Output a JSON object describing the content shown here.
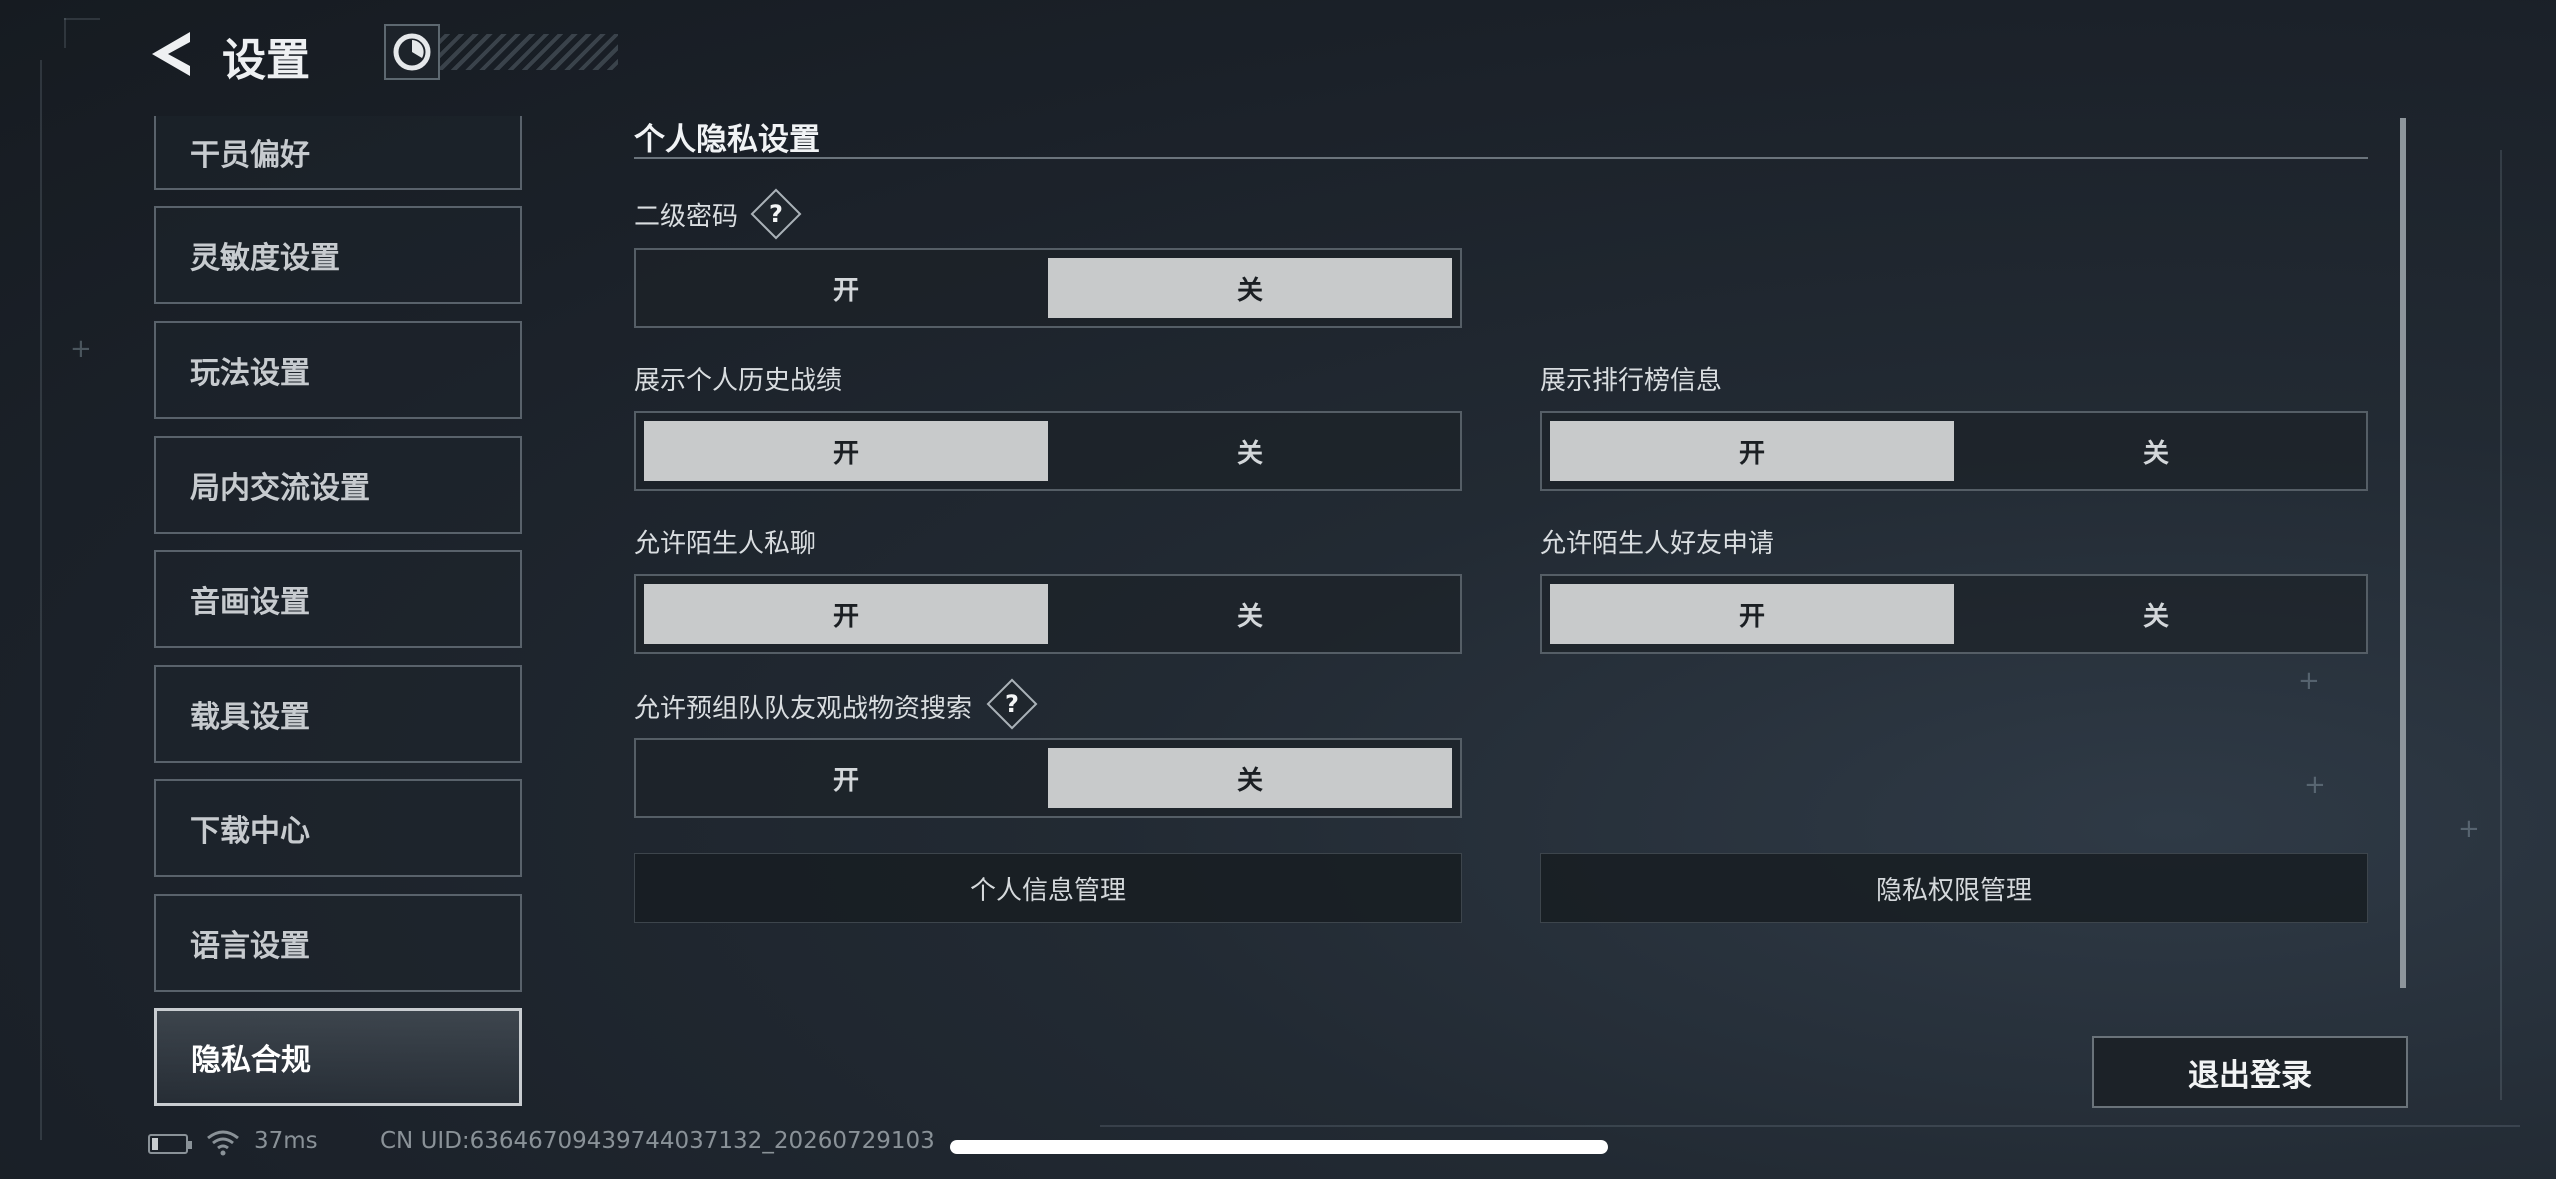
{
  "header": {
    "title": "设置",
    "back_icon": "back-arrow-icon",
    "logo_icon": "game-logo-icon"
  },
  "sidebar": {
    "items": [
      {
        "label": "干员偏好",
        "active": false
      },
      {
        "label": "灵敏度设置",
        "active": false
      },
      {
        "label": "玩法设置",
        "active": false
      },
      {
        "label": "局内交流设置",
        "active": false
      },
      {
        "label": "音画设置",
        "active": false
      },
      {
        "label": "载具设置",
        "active": false
      },
      {
        "label": "下载中心",
        "active": false
      },
      {
        "label": "语言设置",
        "active": false
      },
      {
        "label": "隐私合规",
        "active": true
      }
    ]
  },
  "main": {
    "section_title": "个人隐私设置",
    "settings": {
      "secondary_password": {
        "label": "二级密码",
        "help": "?",
        "on_label": "开",
        "off_label": "关",
        "value": "关"
      },
      "show_history": {
        "label": "展示个人历史战绩",
        "on_label": "开",
        "off_label": "关",
        "value": "开"
      },
      "show_leaderboard": {
        "label": "展示排行榜信息",
        "on_label": "开",
        "off_label": "关",
        "value": "开"
      },
      "stranger_chat": {
        "label": "允许陌生人私聊",
        "on_label": "开",
        "off_label": "关",
        "value": "开"
      },
      "stranger_friend": {
        "label": "允许陌生人好友申请",
        "on_label": "开",
        "off_label": "关",
        "value": "开"
      },
      "team_view_search": {
        "label": "允许预组队队友观战物资搜索",
        "help": "?",
        "on_label": "开",
        "off_label": "关",
        "value": "关"
      }
    },
    "buttons": {
      "personal_info": "个人信息管理",
      "privacy_permissions": "隐私权限管理"
    },
    "logout": "退出登录"
  },
  "footer": {
    "ping": "37ms",
    "uid": "CN UID:63646709439744037132_20260729103",
    "battery_icon": "battery-icon",
    "wifi_icon": "wifi-icon"
  },
  "colors": {
    "background": "#1b2129",
    "toggle_selected": "#c8cacb",
    "border": "#555e66"
  }
}
